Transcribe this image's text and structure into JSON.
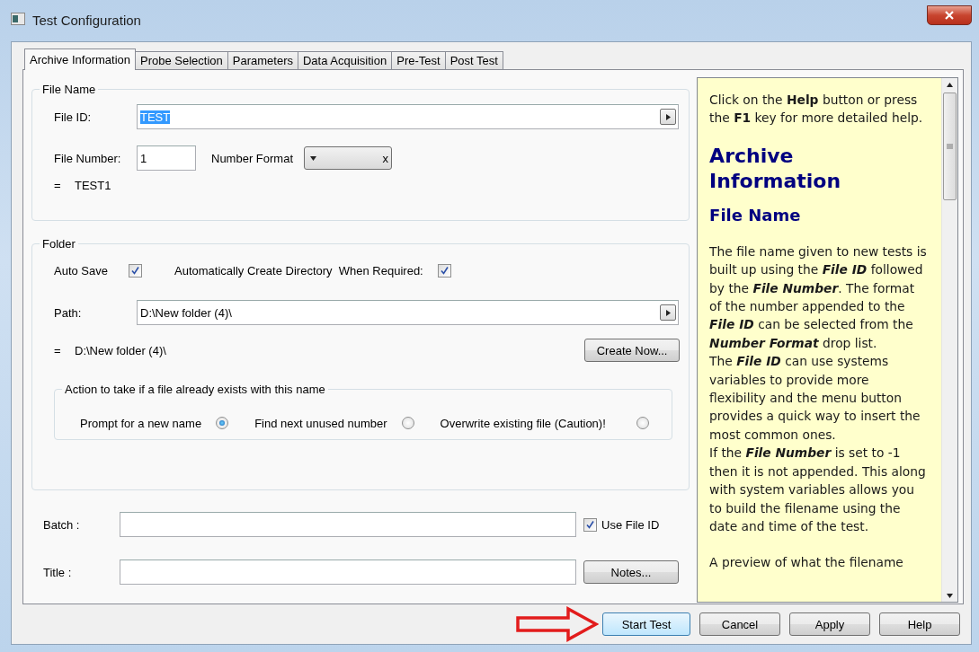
{
  "window": {
    "title": "Test Configuration"
  },
  "tabs": [
    {
      "label": "Archive Information",
      "selected": true
    },
    {
      "label": "Probe Selection",
      "selected": false
    },
    {
      "label": "Parameters",
      "selected": false
    },
    {
      "label": "Data Acquisition",
      "selected": false
    },
    {
      "label": "Pre-Test",
      "selected": false
    },
    {
      "label": "Post Test",
      "selected": false
    }
  ],
  "file_name_group": {
    "legend": "File Name",
    "file_id_label": "File ID:",
    "file_id_value": "TEST",
    "file_id_highlighted": true,
    "file_number_label": "File Number:",
    "file_number_value": "1",
    "number_format_label": "Number Format",
    "number_format_clear": "x",
    "preview_equals": "=",
    "preview": "TEST1"
  },
  "folder_group": {
    "legend": "Folder",
    "auto_save": {
      "label": "Auto Save",
      "checked": true
    },
    "create_directory": {
      "label": "Automatically Create Directory  When Required:",
      "checked": true
    },
    "path_label": "Path:",
    "path_value": "D:\\New folder (4)\\",
    "preview_equals": "=",
    "preview": "D:\\New folder (4)\\",
    "create_button": "Create Now...",
    "action_group": {
      "legend": "Action to take if a file already exists with this name",
      "options": [
        {
          "label": "Prompt for a new name",
          "selected": true
        },
        {
          "label": "Find next unused number",
          "selected": false
        },
        {
          "label": "Overwrite existing file (Caution)!",
          "selected": false
        }
      ]
    }
  },
  "batch": {
    "label": "Batch :",
    "use_file_id": {
      "label": "Use File ID",
      "checked": true
    }
  },
  "title_field": {
    "label": "Title :",
    "notes_button": "Notes..."
  },
  "help": [
    {
      "kind": "intro",
      "paragraphs": [
        "Click on the **Help** button or press the **F1** key for more detailed help."
      ]
    },
    {
      "kind": "heading",
      "paragraphs": [
        "Archive Information"
      ]
    },
    {
      "kind": "subheading",
      "paragraphs": [
        "File Name"
      ]
    },
    {
      "kind": "body",
      "paragraphs": [
        "The file name given to new tests is built up using the **File ID** followed by the **File Number**. The format of the number appended to the **File ID** can be selected from the **Number Format** drop list.",
        "The **File ID** can use systems variables to provide more flexibility and the menu button provides a quick way to insert the most common ones.",
        "If the **File Number** is set to -1 then it is not appended. This along with system variables allows you to build the filename using the date and time of the test."
      ]
    },
    {
      "kind": "body",
      "paragraphs": [
        "A preview of what the filename"
      ]
    }
  ],
  "buttons": [
    {
      "label": "Start Test",
      "default": true
    },
    {
      "label": "Cancel",
      "default": false
    },
    {
      "label": "Apply",
      "default": false
    },
    {
      "label": "Help",
      "default": false
    }
  ]
}
